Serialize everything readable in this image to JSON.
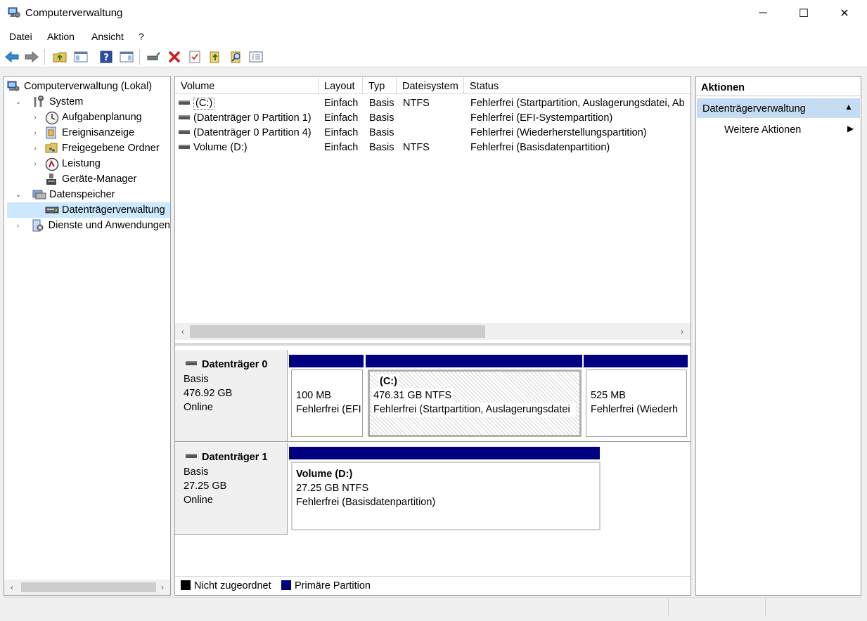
{
  "window": {
    "title": "Computerverwaltung"
  },
  "menu": {
    "items": [
      "Datei",
      "Aktion",
      "Ansicht",
      "?"
    ]
  },
  "tree": {
    "root": "Computerverwaltung (Lokal)",
    "items": [
      {
        "label": "System",
        "icon": "tools-icon"
      },
      {
        "label": "Aufgabenplanung",
        "icon": "clock-icon"
      },
      {
        "label": "Ereignisanzeige",
        "icon": "event-log-icon"
      },
      {
        "label": "Freigegebene Ordner",
        "icon": "shared-folder-icon"
      },
      {
        "label": "Leistung",
        "icon": "performance-icon"
      },
      {
        "label": "Geräte-Manager",
        "icon": "device-manager-icon"
      },
      {
        "label": "Datenspeicher",
        "icon": "storage-icon"
      },
      {
        "label": "Datenträgerverwaltung",
        "icon": "disk-management-icon"
      },
      {
        "label": "Dienste und Anwendungen",
        "icon": "services-icon"
      }
    ]
  },
  "volume_list": {
    "columns": [
      "Volume",
      "Layout",
      "Typ",
      "Dateisystem",
      "Status"
    ],
    "rows": [
      {
        "volume": "(C:)",
        "layout": "Einfach",
        "type": "Basis",
        "fs": "NTFS",
        "status": "Fehlerfrei (Startpartition, Auslagerungsdatei, Ab"
      },
      {
        "volume": "(Datenträger 0 Partition 1)",
        "layout": "Einfach",
        "type": "Basis",
        "fs": "",
        "status": "Fehlerfrei (EFI-Systempartition)"
      },
      {
        "volume": "(Datenträger 0 Partition 4)",
        "layout": "Einfach",
        "type": "Basis",
        "fs": "",
        "status": "Fehlerfrei (Wiederherstellungspartition)"
      },
      {
        "volume": "Volume (D:)",
        "layout": "Einfach",
        "type": "Basis",
        "fs": "NTFS",
        "status": "Fehlerfrei (Basisdatenpartition)"
      }
    ]
  },
  "disks": [
    {
      "name": "Datenträger 0",
      "type": "Basis",
      "size": "476.92 GB",
      "state": "Online",
      "partitions": [
        {
          "title": "",
          "size": "100 MB",
          "status": "Fehlerfrei (EFI"
        },
        {
          "title": "(C:)",
          "size": "476.31 GB NTFS",
          "status": "Fehlerfrei (Startpartition, Auslagerungsdatei"
        },
        {
          "title": "",
          "size": "525 MB",
          "status": "Fehlerfrei (Wiederh"
        }
      ]
    },
    {
      "name": "Datenträger 1",
      "type": "Basis",
      "size": "27.25 GB",
      "state": "Online",
      "partitions": [
        {
          "title": "Volume  (D:)",
          "size": "27.25 GB NTFS",
          "status": "Fehlerfrei (Basisdatenpartition)"
        }
      ]
    }
  ],
  "legend": [
    {
      "label": "Nicht zugeordnet",
      "color": "#000000"
    },
    {
      "label": "Primäre Partition",
      "color": "#000080"
    }
  ],
  "actions": {
    "header": "Aktionen",
    "section": "Datenträgerverwaltung",
    "item": "Weitere Aktionen"
  },
  "colors": {
    "selection": "#cce8ff",
    "partition_bar": "#000080"
  }
}
